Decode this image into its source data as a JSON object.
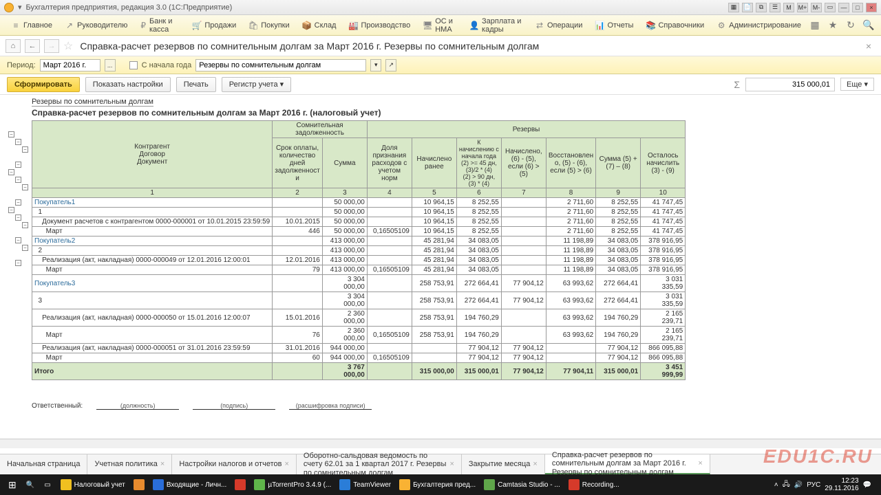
{
  "window": {
    "title": "Бухгалтерия предприятия, редакция 3.0  (1С:Предприятие)"
  },
  "menu": {
    "items": [
      {
        "label": "Главное",
        "icon": "≡"
      },
      {
        "label": "Руководителю",
        "icon": "↗"
      },
      {
        "label": "Банк и касса",
        "icon": "₽"
      },
      {
        "label": "Продажи",
        "icon": "🛒"
      },
      {
        "label": "Покупки",
        "icon": "🛍"
      },
      {
        "label": "Склад",
        "icon": "📦"
      },
      {
        "label": "Производство",
        "icon": "🏭"
      },
      {
        "label": "ОС и НМА",
        "icon": "🖥"
      },
      {
        "label": "Зарплата и кадры",
        "icon": "👤"
      },
      {
        "label": "Операции",
        "icon": "⇄"
      },
      {
        "label": "Отчеты",
        "icon": "📊"
      },
      {
        "label": "Справочники",
        "icon": "📚"
      },
      {
        "label": "Администрирование",
        "icon": "⚙"
      }
    ]
  },
  "page": {
    "title": "Справка-расчет резервов по сомнительным долгам за Март 2016 г. Резервы по сомнительным долгам"
  },
  "filter": {
    "period_label": "Период:",
    "period_value": "Март 2016 г.",
    "since_start": "С начала года",
    "type_value": "Резервы по сомнительным долгам"
  },
  "toolbar": {
    "generate": "Сформировать",
    "settings": "Показать настройки",
    "print": "Печать",
    "register": "Регистр учета ▾",
    "sum": "315 000,01",
    "more": "Еще ▾"
  },
  "report": {
    "sub": "Резервы по сомнительным долгам",
    "title": "Справка-расчет резервов по сомнительным долгам за Март 2016 г. (налоговый учет)",
    "headers": {
      "g1": "Контрагент\nДоговор\nДокумент",
      "g2": "Сомнительная задолженность",
      "g3": "Резервы",
      "c2": "Срок оплаты, количество дней задолженност и",
      "c3": "Сумма",
      "c4": "Доля признания расходов с учетом норм",
      "c5": "Начислено ранее",
      "c6": "К начислению с начала года (2) >= 45 дн, (3)/2 * (4)\n(2) > 90 дн, (3) * (4)",
      "c7": "Начислено, (6) - (5), если (6) > (5)",
      "c8": "Восстановлен о, (5) - (6), если (5) > (6)",
      "c9": "Сумма (5) + (7) – (8)",
      "c10": "Осталось начислить (3) - (9)"
    },
    "colnums": [
      "1",
      "2",
      "3",
      "4",
      "5",
      "6",
      "7",
      "8",
      "9",
      "10"
    ],
    "rows": [
      {
        "cls": "grp",
        "c": [
          "Покупатель1",
          "",
          "50 000,00",
          "",
          "10 964,15",
          "8 252,55",
          "",
          "2 711,60",
          "8 252,55",
          "41 747,45"
        ]
      },
      {
        "c": [
          "  1",
          "",
          "50 000,00",
          "",
          "10 964,15",
          "8 252,55",
          "",
          "2 711,60",
          "8 252,55",
          "41 747,45"
        ]
      },
      {
        "c": [
          "    Документ расчетов с контрагентом 0000-000001 от 10.01.2015 23:59:59",
          "10.01.2015",
          "50 000,00",
          "",
          "10 964,15",
          "8 252,55",
          "",
          "2 711,60",
          "8 252,55",
          "41 747,45"
        ]
      },
      {
        "c": [
          "      Март",
          "446",
          "50 000,00",
          "0,16505109",
          "10 964,15",
          "8 252,55",
          "",
          "2 711,60",
          "8 252,55",
          "41 747,45"
        ]
      },
      {
        "cls": "grp",
        "c": [
          "Покупатель2",
          "",
          "413 000,00",
          "",
          "45 281,94",
          "34 083,05",
          "",
          "11 198,89",
          "34 083,05",
          "378 916,95"
        ]
      },
      {
        "c": [
          "  2",
          "",
          "413 000,00",
          "",
          "45 281,94",
          "34 083,05",
          "",
          "11 198,89",
          "34 083,05",
          "378 916,95"
        ]
      },
      {
        "c": [
          "    Реализация (акт, накладная) 0000-000049 от 12.01.2016 12:00:01",
          "12.01.2016",
          "413 000,00",
          "",
          "45 281,94",
          "34 083,05",
          "",
          "11 198,89",
          "34 083,05",
          "378 916,95"
        ]
      },
      {
        "c": [
          "      Март",
          "79",
          "413 000,00",
          "0,16505109",
          "45 281,94",
          "34 083,05",
          "",
          "11 198,89",
          "34 083,05",
          "378 916,95"
        ]
      },
      {
        "cls": "grp",
        "c": [
          "Покупатель3",
          "",
          "3 304 000,00",
          "",
          "258 753,91",
          "272 664,41",
          "77 904,12",
          "63 993,62",
          "272 664,41",
          "3 031 335,59"
        ]
      },
      {
        "c": [
          "  3",
          "",
          "3 304 000,00",
          "",
          "258 753,91",
          "272 664,41",
          "77 904,12",
          "63 993,62",
          "272 664,41",
          "3 031 335,59"
        ]
      },
      {
        "c": [
          "    Реализация (акт, накладная) 0000-000050 от 15.01.2016 12:00:07",
          "15.01.2016",
          "2 360 000,00",
          "",
          "258 753,91",
          "194 760,29",
          "",
          "63 993,62",
          "194 760,29",
          "2 165 239,71"
        ]
      },
      {
        "c": [
          "      Март",
          "76",
          "2 360 000,00",
          "0,16505109",
          "258 753,91",
          "194 760,29",
          "",
          "63 993,62",
          "194 760,29",
          "2 165 239,71"
        ]
      },
      {
        "c": [
          "    Реализация (акт, накладная) 0000-000051 от 31.01.2016 23:59:59",
          "31.01.2016",
          "944 000,00",
          "",
          "",
          "77 904,12",
          "77 904,12",
          "",
          "77 904,12",
          "866 095,88"
        ]
      },
      {
        "c": [
          "      Март",
          "60",
          "944 000,00",
          "0,16505109",
          "",
          "77 904,12",
          "77 904,12",
          "",
          "77 904,12",
          "866 095,88"
        ]
      }
    ],
    "total": {
      "label": "Итого",
      "c": [
        "",
        "3 767 000,00",
        "",
        "315 000,00",
        "315 000,01",
        "77 904,12",
        "77 904,11",
        "315 000,01",
        "3 451 999,99"
      ]
    },
    "sign": {
      "resp": "Ответственный:",
      "pos": "(должность)",
      "sig": "(подпись)",
      "dec": "(расшифровка подписи)"
    }
  },
  "tabs": [
    {
      "label": "Начальная страница"
    },
    {
      "label": "Учетная политика",
      "close": true
    },
    {
      "label": "Настройки налогов и отчетов",
      "close": true
    },
    {
      "label": "Оборотно-сальдовая ведомость по счету 62.01 за 1 квартал 2017 г. Резервы по сомнительным долгам",
      "close": true
    },
    {
      "label": "Закрытие месяца",
      "close": true
    },
    {
      "label": "Справка-расчет резервов по сомнительным долгам за Март 2016 г. Резервы по сомнительным долгам",
      "close": true,
      "active": true
    }
  ],
  "taskbar": {
    "items": [
      {
        "label": "Налоговый учет",
        "color": "#f0c020"
      },
      {
        "label": "",
        "color": "#e88b2e"
      },
      {
        "label": "Входящие - Личн...",
        "color": "#2a6dd8"
      },
      {
        "label": "",
        "color": "#d63a2a"
      },
      {
        "label": "µTorrentPro 3.4.9 (...",
        "color": "#5fb54a"
      },
      {
        "label": "TeamViewer",
        "color": "#2a7dd8"
      },
      {
        "label": "Бухгалтерия пред...",
        "color": "#f9b233"
      },
      {
        "label": "Camtasia Studio - ...",
        "color": "#5fa64a"
      },
      {
        "label": "Recording...",
        "color": "#d63a2a"
      }
    ],
    "time": "12:23",
    "date": "29.11.2016",
    "lang": "РУС"
  },
  "watermark": "EDU1C.RU"
}
